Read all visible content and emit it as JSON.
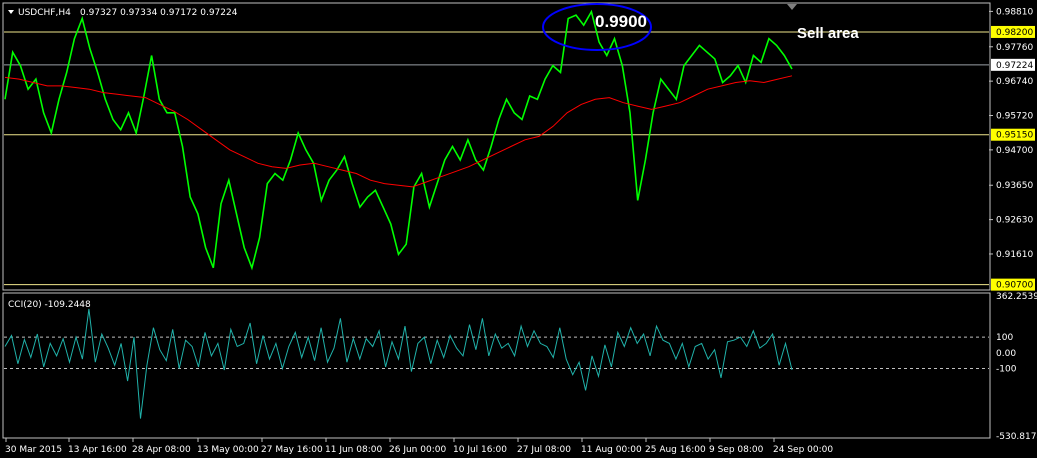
{
  "header": {
    "symbol": "USDCHF,H4",
    "ohlc": "0.97327 0.97334 0.97172 0.97224"
  },
  "annotations": {
    "price_callout": "0.9900",
    "sell_area": "Sell area"
  },
  "colors": {
    "background": "#000000",
    "price": "#00ff00",
    "moving_average": "#ff0000",
    "cci": "#20b2aa",
    "level_lines": "#f0e68c",
    "callout_ellipse": "#0000ff"
  },
  "chart_data": [
    {
      "type": "line",
      "title": "USDCHF,H4",
      "y_ticks": [
        "0.98810",
        "0.97760",
        "0.96740",
        "0.95720",
        "0.94700",
        "0.93650",
        "0.92630",
        "0.91610"
      ],
      "ylim": [
        0.906,
        0.99
      ],
      "horizontal_levels": [
        {
          "label": "0.98200",
          "value": 0.982,
          "highlight": true
        },
        {
          "label": "0.97224",
          "value": 0.97224,
          "highlight": false
        },
        {
          "label": "0.95150",
          "value": 0.9515,
          "highlight": true
        },
        {
          "label": "0.90700",
          "value": 0.907,
          "highlight": true
        }
      ],
      "series": [
        {
          "name": "",
          "values": [
            0.962,
            0.976,
            0.972,
            0.965,
            0.968,
            0.958,
            0.952,
            0.962,
            0.97,
            0.98,
            0.986,
            0.977,
            0.97,
            0.962,
            0.956,
            0.953,
            0.958,
            0.952,
            0.963,
            0.975,
            0.962,
            0.958,
            0.958,
            0.948,
            0.933,
            0.928,
            0.918,
            0.912,
            0.931,
            0.938,
            0.928,
            0.918,
            0.912,
            0.921,
            0.937,
            0.94,
            0.938,
            0.944,
            0.952,
            0.947,
            0.943,
            0.932,
            0.938,
            0.941,
            0.945,
            0.937,
            0.93,
            0.933,
            0.935,
            0.93,
            0.925,
            0.916,
            0.919,
            0.936,
            0.94,
            0.93,
            0.937,
            0.944,
            0.948,
            0.944,
            0.95,
            0.944,
            0.941,
            0.948,
            0.956,
            0.962,
            0.958,
            0.956,
            0.963,
            0.962,
            0.968,
            0.972,
            0.97,
            0.986,
            0.987,
            0.984,
            0.988,
            0.979,
            0.975,
            0.98,
            0.972,
            0.958,
            0.932,
            0.944,
            0.958,
            0.968,
            0.965,
            0.962,
            0.972,
            0.975,
            0.978,
            0.976,
            0.974,
            0.967,
            0.969,
            0.972,
            0.967,
            0.975,
            0.973,
            0.98,
            0.978,
            0.975,
            0.971
          ],
          "color": "#00ff00"
        },
        {
          "name": "",
          "values": [
            0.9685,
            0.968,
            0.967,
            0.966,
            0.966,
            0.9655,
            0.965,
            0.964,
            0.9635,
            0.963,
            0.9625,
            0.9605,
            0.9585,
            0.956,
            0.953,
            0.95,
            0.947,
            0.945,
            0.943,
            0.942,
            0.9415,
            0.9425,
            0.943,
            0.942,
            0.941,
            0.94,
            0.938,
            0.937,
            0.9365,
            0.936,
            0.9375,
            0.939,
            0.9405,
            0.942,
            0.944,
            0.946,
            0.948,
            0.95,
            0.951,
            0.954,
            0.958,
            0.9605,
            0.962,
            0.9625,
            0.961,
            0.96,
            0.959,
            0.96,
            0.961,
            0.963,
            0.965,
            0.966,
            0.967,
            0.9675,
            0.967,
            0.968,
            0.969
          ],
          "color": "#ff0000"
        }
      ]
    },
    {
      "type": "line",
      "title": "CCI(20) -109.2448",
      "y_ticks": [
        "362.2539",
        "100",
        "0.00",
        "-100",
        "-530.8174"
      ],
      "ylim": [
        -530.8174,
        362.2539
      ],
      "dashed_levels": [
        100,
        -100
      ],
      "series": [
        {
          "name": "CCI(20)",
          "values": [
            40,
            110,
            -70,
            85,
            -30,
            120,
            -90,
            60,
            -20,
            90,
            -60,
            100,
            -40,
            280,
            -60,
            120,
            30,
            -80,
            60,
            -180,
            100,
            -420,
            -80,
            160,
            20,
            -50,
            150,
            -100,
            80,
            40,
            -90,
            130,
            -20,
            60,
            -110,
            150,
            40,
            60,
            190,
            -70,
            110,
            -40,
            60,
            -100,
            40,
            130,
            -30,
            100,
            -50,
            160,
            -60,
            30,
            220,
            -60,
            90,
            -40,
            90,
            40,
            140,
            -90,
            70,
            -40,
            170,
            -120,
            60,
            100,
            -70,
            80,
            -30,
            110,
            30,
            -20,
            180,
            20,
            220,
            -20,
            120,
            30,
            60,
            -20,
            170,
            40,
            140,
            60,
            40,
            -30,
            160,
            -40,
            -140,
            -60,
            -240,
            -20,
            -150,
            50,
            -90,
            130,
            40,
            160,
            60,
            120,
            -20,
            170,
            80,
            60,
            -40,
            60,
            -90,
            40,
            60,
            -40,
            20,
            -160,
            70,
            80,
            100,
            40,
            140,
            30,
            60,
            120,
            -80,
            60,
            -109
          ],
          "color": "#20b2aa"
        }
      ]
    }
  ],
  "x_ticks": [
    "30 Mar 2015",
    "13 Apr 16:00",
    "28 Apr 08:00",
    "13 May 00:00",
    "27 May 16:00",
    "11 Jun 08:00",
    "26 Jun 00:00",
    "10 Jul 16:00",
    "27 Jul 08:00",
    "11 Aug 00:00",
    "25 Aug 16:00",
    "9 Sep 08:00",
    "24 Sep 00:00"
  ]
}
